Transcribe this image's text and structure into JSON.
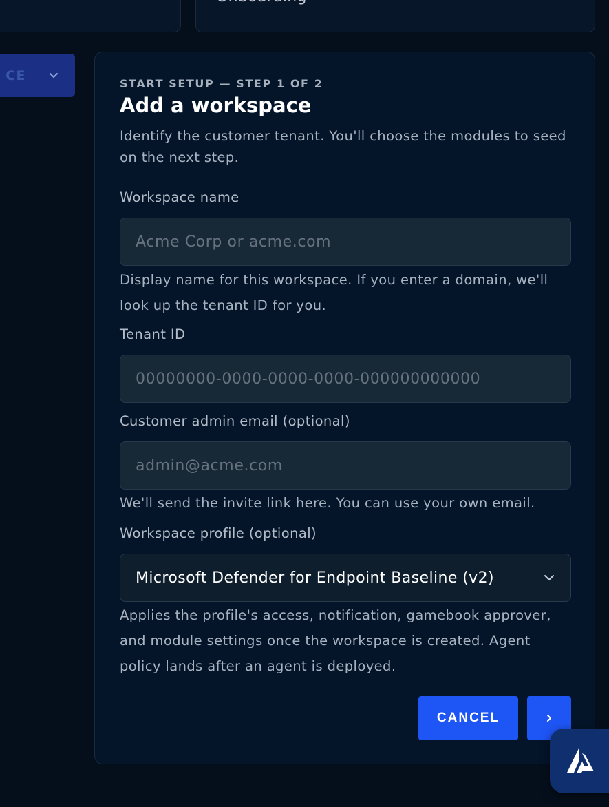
{
  "top_cards": {
    "right_label": "Onboarding"
  },
  "split_button": {
    "label": "CE"
  },
  "form": {
    "eyebrow": "START SETUP — STEP 1 OF 2",
    "title": "Add a workspace",
    "subtitle": "Identify the customer tenant. You'll choose the modules to seed on the next step.",
    "workspace_name": {
      "label": "Workspace name",
      "placeholder": "Acme Corp or acme.com",
      "help": "Display name for this workspace. If you enter a domain, we'll look up the tenant ID for you."
    },
    "tenant_id": {
      "label": "Tenant ID",
      "placeholder": "00000000-0000-0000-0000-000000000000"
    },
    "admin_email": {
      "label": "Customer admin email (optional)",
      "placeholder": "admin@acme.com",
      "help": "We'll send the invite link here. You can use your own email."
    },
    "profile": {
      "label": "Workspace profile (optional)",
      "selected": "Microsoft Defender for Endpoint Baseline (v2)",
      "help": "Applies the profile's access, notification, gamebook approver, and module settings once the workspace is created. Agent policy lands after an agent is deployed."
    },
    "actions": {
      "cancel_label": "CANCEL",
      "next_icon": "chevron-right-icon"
    }
  },
  "fab": {
    "icon": "brand-logo-icon"
  },
  "colors": {
    "background": "#050f1c",
    "panel": "#041529",
    "accent": "#1e55f5"
  }
}
